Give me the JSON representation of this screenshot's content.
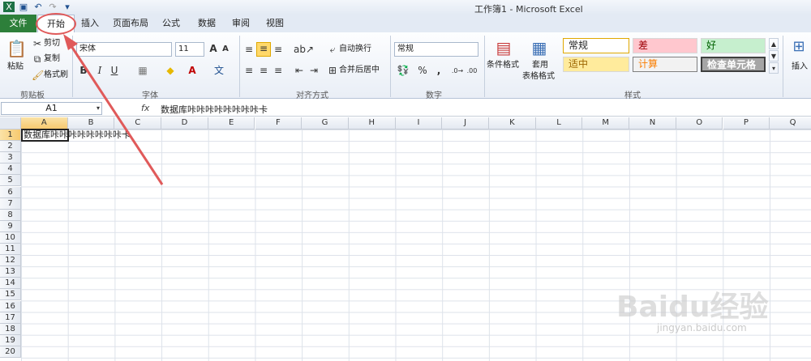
{
  "window": {
    "title": "工作簿1 - Microsoft Excel"
  },
  "tabs": {
    "file": "文件",
    "items": [
      "开始",
      "插入",
      "页面布局",
      "公式",
      "数据",
      "审阅",
      "视图"
    ]
  },
  "ribbon": {
    "clipboard": {
      "paste": "粘贴",
      "cut": "剪切",
      "copy": "复制",
      "format_painter": "格式刷",
      "label": "剪贴板"
    },
    "font": {
      "name": "宋体",
      "size": "11",
      "label": "字体"
    },
    "alignment": {
      "wrap": "自动换行",
      "merge": "合并后居中",
      "label": "对齐方式"
    },
    "number": {
      "format": "常规",
      "label": "数字"
    },
    "styles": {
      "cond_format": "条件格式",
      "table_format_1": "套用",
      "table_format_2": "表格格式",
      "normal": "常规",
      "bad": "差",
      "good": "好",
      "neutral": "适中",
      "calc": "计算",
      "check": "检查单元格",
      "label": "样式"
    },
    "cells": {
      "insert": "插入"
    }
  },
  "formula_bar": {
    "name_box": "A1",
    "fx": "fx",
    "content": "数据库咔咔咔咔咔咔咔咔卡"
  },
  "sheet": {
    "columns": [
      "A",
      "B",
      "C",
      "D",
      "E",
      "F",
      "G",
      "H",
      "I",
      "J",
      "K",
      "L",
      "M",
      "N",
      "O",
      "P",
      "Q"
    ],
    "rows": [
      "1",
      "2",
      "3",
      "4",
      "5",
      "6",
      "7",
      "8",
      "9",
      "10",
      "11",
      "12",
      "13",
      "14",
      "15",
      "16",
      "17",
      "18",
      "19",
      "20"
    ],
    "cell_a1": "数据库咔咔咔咔咔咔咔咔卡"
  },
  "watermark": {
    "main": "Baidu经验",
    "sub": "jingyan.baidu.com"
  },
  "colors": {
    "file_tab": "#2d7f3a",
    "annotation": "#e05a5a",
    "selection": "#f7c96f"
  }
}
